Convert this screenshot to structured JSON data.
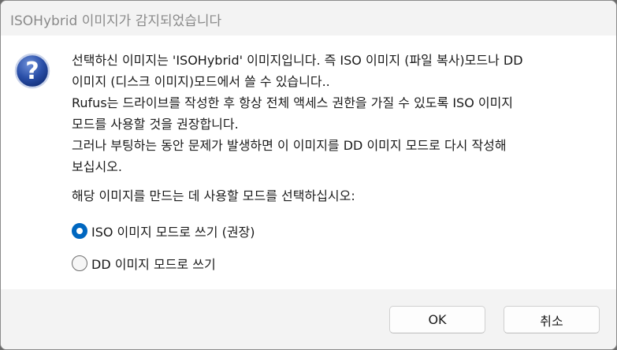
{
  "window": {
    "title": "ISOHybrid 이미지가 감지되었습니다"
  },
  "dialog": {
    "icon": "question-icon",
    "message_lines": [
      "선택하신 이미지는 'ISOHybrid' 이미지입니다. 즉 ISO 이미지 (파일 복사)모드나 DD",
      "이미지 (디스크 이미지)모드에서 쓸 수 있습니다..",
      "Rufus는 드라이브를 작성한 후 항상 전체 액세스 권한을 가질 수 있도록 ISO 이미지",
      "모드를 사용할 것을 권장합니다.",
      "그러나 부팅하는 동안 문제가 발생하면 이 이미지를 DD 이미지 모드로 다시 작성해",
      "보십시오."
    ],
    "prompt": "해당 이미지를 만드는 데 사용할 모드를 선택하십시오:",
    "options": [
      {
        "label": "ISO 이미지 모드로 쓰기 (권장)",
        "selected": true
      },
      {
        "label": "DD 이미지 모드로 쓰기",
        "selected": false
      }
    ]
  },
  "buttons": {
    "ok_label": "OK",
    "cancel_label": "취소"
  },
  "colors": {
    "accent": "#0067c0",
    "icon_blue": "#1a3f8f"
  }
}
